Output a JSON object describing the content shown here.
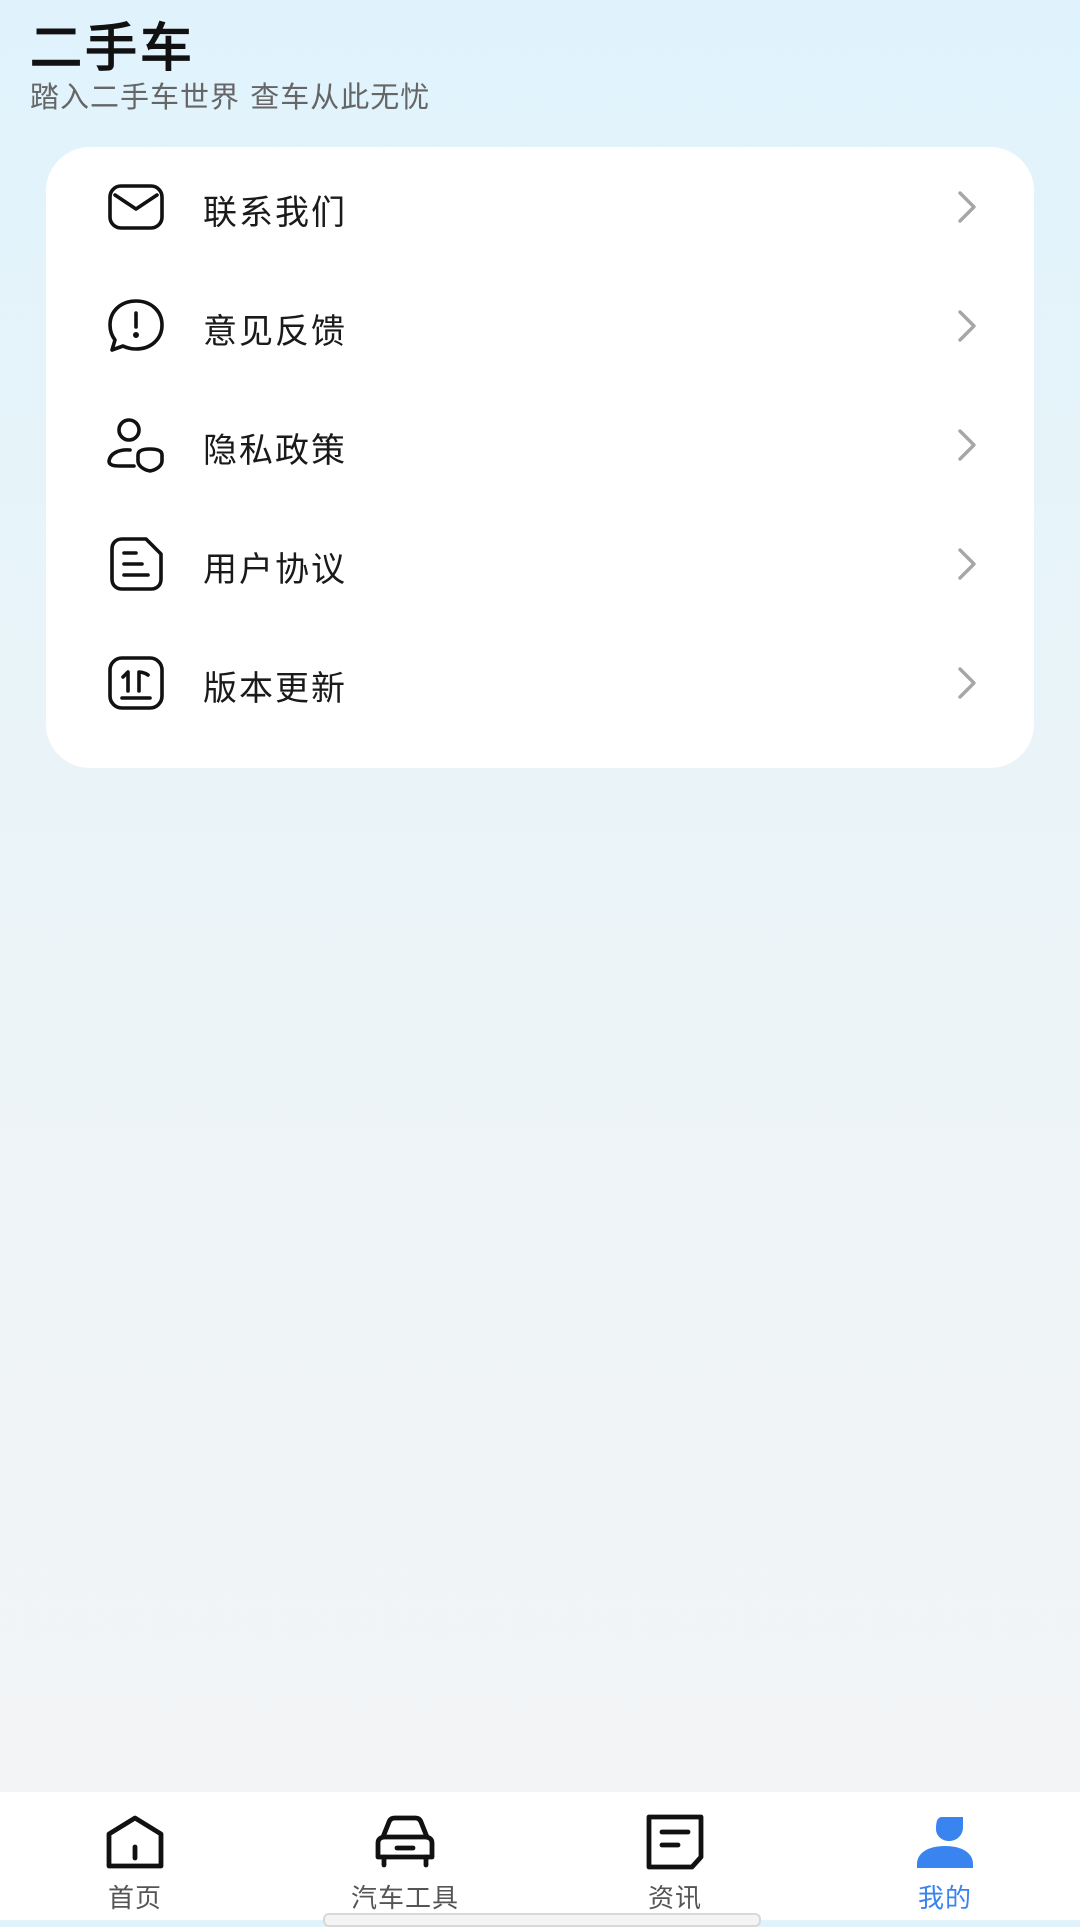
{
  "header": {
    "title": "二手车",
    "subtitle": "踏入二手车世界 查车从此无忧"
  },
  "menu": {
    "items": [
      {
        "label": "联系我们",
        "icon": "mail-icon"
      },
      {
        "label": "意见反馈",
        "icon": "feedback-icon"
      },
      {
        "label": "隐私政策",
        "icon": "privacy-icon"
      },
      {
        "label": "用户协议",
        "icon": "document-icon"
      },
      {
        "label": "版本更新",
        "icon": "update-icon"
      }
    ]
  },
  "tabbar": {
    "active_color": "#3a84f0",
    "items": [
      {
        "label": "首页",
        "icon": "home-icon",
        "active": false
      },
      {
        "label": "汽车工具",
        "icon": "car-icon",
        "active": false
      },
      {
        "label": "资讯",
        "icon": "news-icon",
        "active": false
      },
      {
        "label": "我的",
        "icon": "profile-icon",
        "active": true
      }
    ]
  }
}
